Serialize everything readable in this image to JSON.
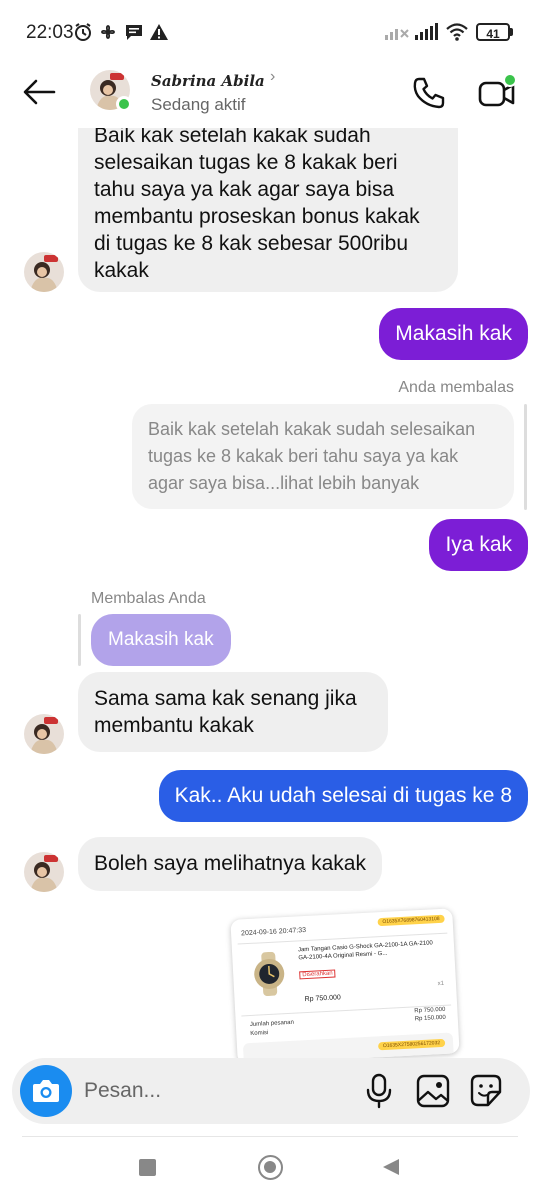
{
  "status_bar": {
    "time": "22:03",
    "battery": "41"
  },
  "header": {
    "contact_name": "Sabrina Abila",
    "status": "Sedang aktif",
    "colors": {
      "online": "#3ac34b"
    }
  },
  "messages": [
    {
      "direction": "in",
      "text_lines": [
        "Baik kak setelah kakak sudah",
        "selesaikan tugas ke 8 kakak beri",
        "tahu saya ya kak agar saya bisa",
        "membantu proseskan bonus kakak",
        "di tugas ke 8 kak sebesar 500ribu",
        "kakak"
      ]
    },
    {
      "direction": "out",
      "text": "Makasih kak"
    },
    {
      "direction": "out",
      "reply_label": "Anda membalas",
      "quoted_lines": [
        "Baik kak setelah kakak sudah selesaikan",
        "tugas ke 8 kakak beri tahu saya ya kak",
        "agar saya bisa...lihat lebih banyak"
      ],
      "text": "Iya kak"
    },
    {
      "direction": "in",
      "reply_label": "Membalas Anda",
      "quoted_text": "Makasih kak",
      "text_lines": [
        "Sama sama kak senang jika",
        "membantu kakak"
      ]
    },
    {
      "direction": "out",
      "text": "Kak.. Aku udah selesai di tugas ke 8"
    },
    {
      "direction": "in",
      "text": "Boleh saya melihatnya kakak"
    }
  ],
  "receipt": {
    "date": "2024-09-16 20:47:33",
    "order_id": "O1635X76898760413108",
    "product": "Jam Tangan Casio G-Shock GA-2100-1A GA-2100 GA-2100-4A Original Resmi - G...",
    "badge": "Diserahkan",
    "qty": "x1",
    "price": "Rp 750.000",
    "label_total": "Jumlah pesanan",
    "label_commission": "Komisi",
    "total": "Rp 750.000",
    "commission": "Rp 150.000",
    "order_id_2": "O1635X27580256172032"
  },
  "composer": {
    "placeholder": "Pesan..."
  },
  "colors": {
    "out_purple": "#7c1ed6",
    "out_blue": "#2a5ee6",
    "quoted_in": "#b2a3ea",
    "in_bubble": "#efefef",
    "camera": "#1a8cf0"
  }
}
